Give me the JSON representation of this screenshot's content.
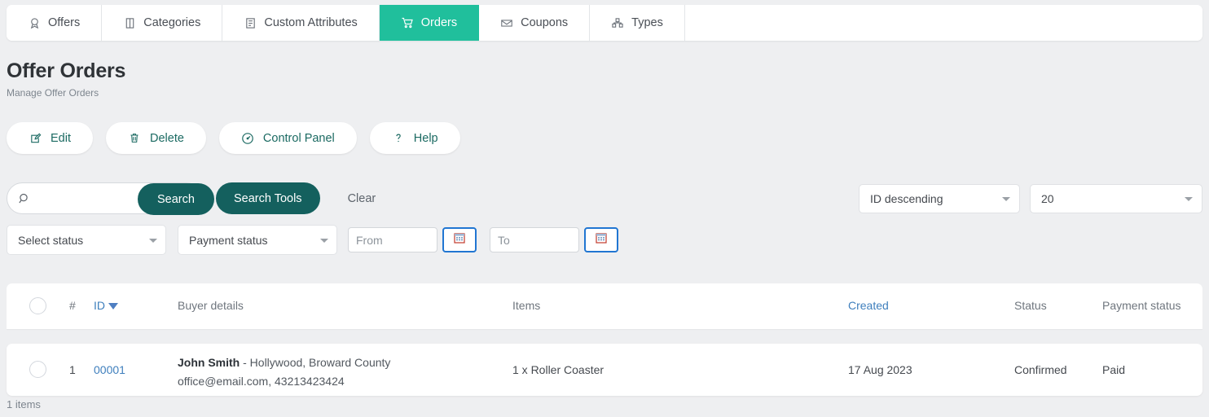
{
  "tabs": [
    {
      "label": "Offers",
      "icon": "award-icon",
      "active": false
    },
    {
      "label": "Categories",
      "icon": "book-icon",
      "active": false
    },
    {
      "label": "Custom Attributes",
      "icon": "attribute-icon",
      "active": false
    },
    {
      "label": "Orders",
      "icon": "cart-icon",
      "active": true
    },
    {
      "label": "Coupons",
      "icon": "coupon-icon",
      "active": false
    },
    {
      "label": "Types",
      "icon": "types-icon",
      "active": false
    }
  ],
  "heading": {
    "title": "Offer Orders",
    "subtitle": "Manage Offer Orders"
  },
  "actions": [
    {
      "label": "Edit",
      "icon": "edit-icon"
    },
    {
      "label": "Delete",
      "icon": "trash-icon"
    },
    {
      "label": "Control Panel",
      "icon": "gauge-icon"
    },
    {
      "label": "Help",
      "icon": "question-icon"
    }
  ],
  "search": {
    "value": "",
    "placeholder": "",
    "icon": "search-icon",
    "search_label": "Search",
    "search_tools_label": "Search Tools",
    "clear_label": "Clear"
  },
  "listing_controls": {
    "sort": {
      "value": "ID descending"
    },
    "per_page": {
      "value": "20"
    }
  },
  "filters": {
    "status": {
      "value": "Select status"
    },
    "payment_status": {
      "value": "Payment status"
    },
    "date_from": {
      "value": "",
      "placeholder": "From",
      "calendar_icon": "calendar-icon"
    },
    "date_to": {
      "value": "",
      "placeholder": "To",
      "calendar_icon": "calendar-icon"
    }
  },
  "table": {
    "headers": {
      "index": "#",
      "id": "ID",
      "buyer": "Buyer details",
      "items": "Items",
      "created": "Created",
      "status": "Status",
      "payment_status": "Payment status"
    },
    "rows": [
      {
        "index": "1",
        "id": "00001",
        "buyer_name": "John Smith",
        "buyer_location": " - Hollywood, Broward County",
        "buyer_contact": "office@email.com, 43213423424",
        "items": "1 x Roller Coaster",
        "created": "17 Aug 2023",
        "status": "Confirmed",
        "payment_status": "Paid"
      }
    ]
  },
  "footer": {
    "count_label": "1 items"
  },
  "colors": {
    "accent_green": "#20bf9c",
    "accent_teal": "#14605e",
    "link_blue": "#3f7fbd",
    "page_bg": "#eeeff1"
  }
}
